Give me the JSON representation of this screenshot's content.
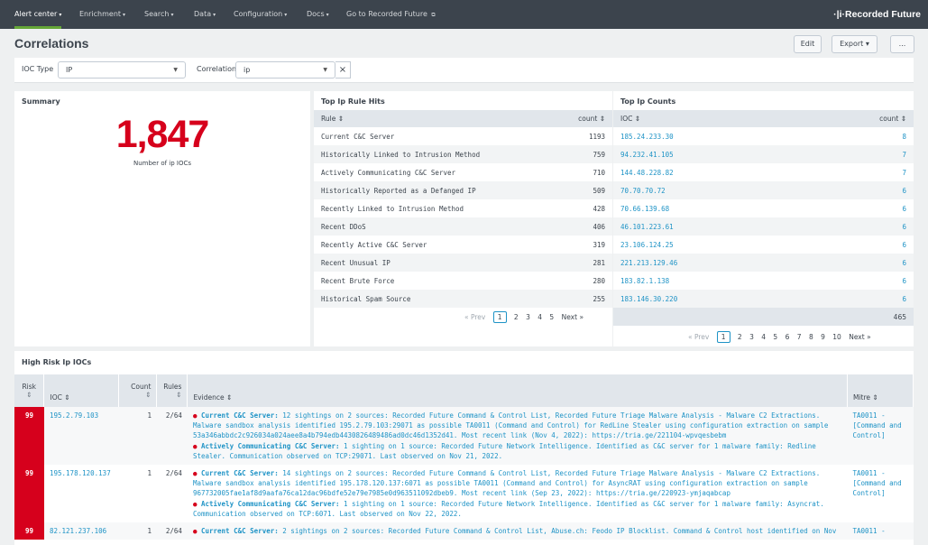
{
  "nav": {
    "items": [
      {
        "label": "Alert center",
        "caret": "▾"
      },
      {
        "label": "Enrichment",
        "caret": "▾"
      },
      {
        "label": "Search",
        "caret": "▾"
      },
      {
        "label": "Data",
        "caret": "▾"
      },
      {
        "label": "Configuration",
        "caret": "▾"
      },
      {
        "label": "Docs",
        "caret": "▾"
      },
      {
        "label": "Go to Recorded Future",
        "caret": "⧉"
      }
    ],
    "brand": "·|i·Recorded Future"
  },
  "header": {
    "title": "Correlations",
    "edit_label": "Edit",
    "export_label": "Export ▾",
    "more_label": "..."
  },
  "filters": {
    "ioc_type_label": "IOC Type",
    "ioc_type_value": "IP",
    "correlation_label": "Correlation",
    "correlation_value": "ip",
    "clear_label": "×"
  },
  "summary": {
    "title": "Summary",
    "count": "1,847",
    "count_label": "Number of ip IOCs"
  },
  "rule_hits": {
    "title": "Top Ip Rule Hits",
    "col_rule": "Rule ⇕",
    "col_count": "count ⇕",
    "rows": [
      {
        "rule": "Current C&C Server",
        "count": "1193"
      },
      {
        "rule": "Historically Linked to Intrusion Method",
        "count": "759"
      },
      {
        "rule": "Actively Communicating C&C Server",
        "count": "710"
      },
      {
        "rule": "Historically Reported as a Defanged IP",
        "count": "509"
      },
      {
        "rule": "Recently Linked to Intrusion Method",
        "count": "428"
      },
      {
        "rule": "Recent DDoS",
        "count": "406"
      },
      {
        "rule": "Recently Active C&C Server",
        "count": "319"
      },
      {
        "rule": "Recent Unusual IP",
        "count": "281"
      },
      {
        "rule": "Recent Brute Force",
        "count": "280"
      },
      {
        "rule": "Historical Spam Source",
        "count": "255"
      }
    ],
    "pager": {
      "prev": "« Prev",
      "pages": [
        "1",
        "2",
        "3",
        "4",
        "5"
      ],
      "next": "Next »"
    }
  },
  "ip_counts": {
    "title": "Top Ip Counts",
    "col_ioc": "IOC ⇕",
    "col_count": "count ⇕",
    "rows": [
      {
        "ioc": "185.24.233.30",
        "count": "8"
      },
      {
        "ioc": "94.232.41.105",
        "count": "7"
      },
      {
        "ioc": "144.48.228.82",
        "count": "7"
      },
      {
        "ioc": "70.70.70.72",
        "count": "6"
      },
      {
        "ioc": "70.66.139.68",
        "count": "6"
      },
      {
        "ioc": "46.101.223.61",
        "count": "6"
      },
      {
        "ioc": "23.106.124.25",
        "count": "6"
      },
      {
        "ioc": "221.213.129.46",
        "count": "6"
      },
      {
        "ioc": "183.82.1.138",
        "count": "6"
      },
      {
        "ioc": "183.146.30.220",
        "count": "6"
      }
    ],
    "total": "465",
    "pager": {
      "prev": "« Prev",
      "pages": [
        "1",
        "2",
        "3",
        "4",
        "5",
        "6",
        "7",
        "8",
        "9",
        "10"
      ],
      "next": "Next »"
    }
  },
  "high_risk": {
    "title": "High Risk Ip IOCs",
    "cols": {
      "risk": "Risk",
      "ioc": "IOC ⇕",
      "count": "Count",
      "rules": "Rules",
      "evidence": "Evidence ⇕",
      "mitre": "Mitre ⇕",
      "sort": "⇕"
    },
    "rows": [
      {
        "risk": "99",
        "ioc": "195.2.79.103",
        "count": "1",
        "rules": "2/64",
        "ev1_title": "Current C&C Server:",
        "ev1_text": "12 sightings on 2 sources: Recorded Future Command & Control List, Recorded Future Triage Malware Analysis - Malware C2 Extractions. Malware sandbox analysis identified 195.2.79.103:29071 as possible TA0011 (Command and Control) for RedLine Stealer using configuration extraction on sample 53a346abbdc2c926034a024aee8a4b794edb4430826489486ad0dc46d1352d41. Most recent link (Nov 4, 2022): https://tria.ge/221104-wpvqesbebm",
        "ev2_title": "Actively Communicating C&C Server:",
        "ev2_text": "1 sighting on 1 source: Recorded Future Network Intelligence. Identified as C&C server for 1 malware family: Redline Stealer. Communication observed on TCP:29071. Last observed on Nov 21, 2022.",
        "mitre": "TA0011 - [Command and Control]"
      },
      {
        "risk": "99",
        "ioc": "195.178.120.137",
        "count": "1",
        "rules": "2/64",
        "ev1_title": "Current C&C Server:",
        "ev1_text": "14 sightings on 2 sources: Recorded Future Command & Control List, Recorded Future Triage Malware Analysis - Malware C2 Extractions. Malware sandbox analysis identified 195.178.120.137:6071 as possible TA0011 (Command and Control) for AsyncRAT using configuration extraction on sample 967732005fae1af8d9aafa76ca12dac96bdfe52e79e7985e0d963511092dbeb9. Most recent link (Sep 23, 2022): https://tria.ge/220923-ymjaqabcap",
        "ev2_title": "Actively Communicating C&C Server:",
        "ev2_text": "1 sighting on 1 source: Recorded Future Network Intelligence. Identified as C&C server for 1 malware family: Asyncrat. Communication observed on TCP:6071. Last observed on Nov 22, 2022.",
        "mitre": "TA0011 - [Command and Control]"
      },
      {
        "risk": "99",
        "ioc": "82.121.237.106",
        "count": "1",
        "rules": "2/64",
        "ev1_title": "Current C&C Server:",
        "ev1_text": "2 sightings on 2 sources: Recorded Future Command & Control List, Abuse.ch: Feodo IP Blocklist. Command & Control host identified on Nov",
        "mitre": "TA0011 -"
      }
    ]
  },
  "colors": {
    "nav_bg": "#3c444d",
    "accent_green": "#65a637",
    "risk_red": "#d6001c",
    "link_blue": "#1e93c6"
  }
}
